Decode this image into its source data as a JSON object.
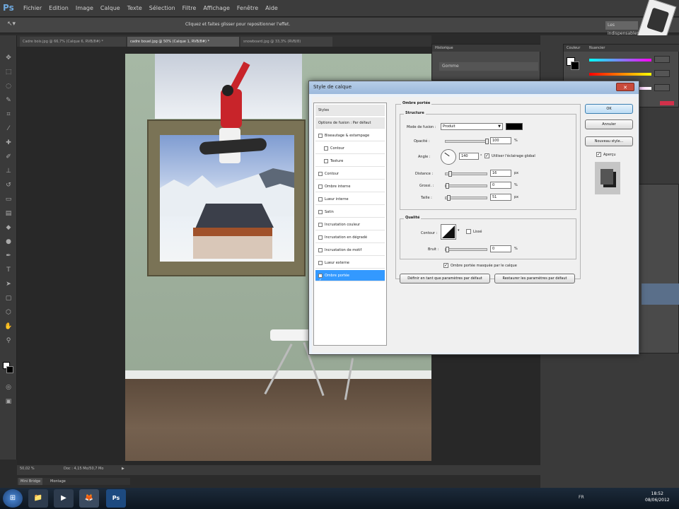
{
  "menubar": {
    "logo": "Ps",
    "items": [
      "Fichier",
      "Edition",
      "Image",
      "Calque",
      "Texte",
      "Sélection",
      "Filtre",
      "Affichage",
      "Fenêtre",
      "Aide"
    ]
  },
  "options": {
    "hint": "Cliquez et faites glisser pour repositionner l'effet.",
    "search": "Les indispensables"
  },
  "tabs": [
    "Cadre bois.jpg @ 66,7% (Calque 6, RVB/8#) *",
    "cadre bouel.jpg @ 50% (Calque 1, RVB/8#) *",
    "snowboard.jpg @ 33,3% (RVB/8)"
  ],
  "status": {
    "zoom": "50,02 %",
    "doc": "Doc : 4,15 Mo/50,7 Mo"
  },
  "bottomtabs": [
    "Mini Bridge",
    "Montage"
  ],
  "history": {
    "header": "Historique",
    "item": "Gomme"
  },
  "colorpanel": {
    "tab1": "Couleur",
    "tab2": "Nuancier"
  },
  "dialog": {
    "title": "Style de calque",
    "close": "✕",
    "left_items": [
      {
        "label": "Styles",
        "check": false,
        "header": true
      },
      {
        "label": "Options de fusion : Par défaut",
        "check": false,
        "header": true
      },
      {
        "label": "Biseautage & estampage",
        "check": true
      },
      {
        "label": "Contour",
        "check": true,
        "indent": true
      },
      {
        "label": "Texture",
        "check": true,
        "indent": true
      },
      {
        "label": "Contour",
        "check": true
      },
      {
        "label": "Ombre interne",
        "check": true
      },
      {
        "label": "Lueur interne",
        "check": true
      },
      {
        "label": "Satin",
        "check": true
      },
      {
        "label": "Incrustation couleur",
        "check": true
      },
      {
        "label": "Incrustation en dégradé",
        "check": true
      },
      {
        "label": "Incrustation de motif",
        "check": true
      },
      {
        "label": "Lueur externe",
        "check": true
      },
      {
        "label": "Ombre portée",
        "check": true,
        "active": true
      }
    ],
    "section_title": "Ombre portée",
    "structure_title": "Structure",
    "blend_label": "Mode de fusion :",
    "blend_value": "Produit",
    "shadow_color": "#000000",
    "opacity_label": "Opacité :",
    "opacity_value": "100",
    "angle_label": "Angle :",
    "angle_value": "140",
    "angle_unit": "°",
    "global_light_label": "Utiliser l'éclairage global",
    "distance_label": "Distance :",
    "distance_value": "16",
    "spread_label": "Grossi. :",
    "spread_value": "0",
    "size_label": "Taille :",
    "size_value": "51",
    "px": "px",
    "pct": "%",
    "quality_title": "Qualité",
    "contour_label": "Contour :",
    "lisse_label": "Lissé",
    "noise_label": "Bruit :",
    "noise_value": "0",
    "knockout_label": "Ombre portée masquée par le calque",
    "default_btn": "Définir en tant que paramètres par défaut",
    "restore_btn": "Restaurer les paramètres par défaut",
    "ok": "OK",
    "cancel": "Annuler",
    "new_style": "Nouveau style...",
    "preview": "Aperçu"
  },
  "taskbar": {
    "lang": "FR",
    "time": "18:52",
    "date": "08/06/2012"
  },
  "colors": {
    "accent": "#3399ff",
    "title_bar": "#b7cee8"
  }
}
